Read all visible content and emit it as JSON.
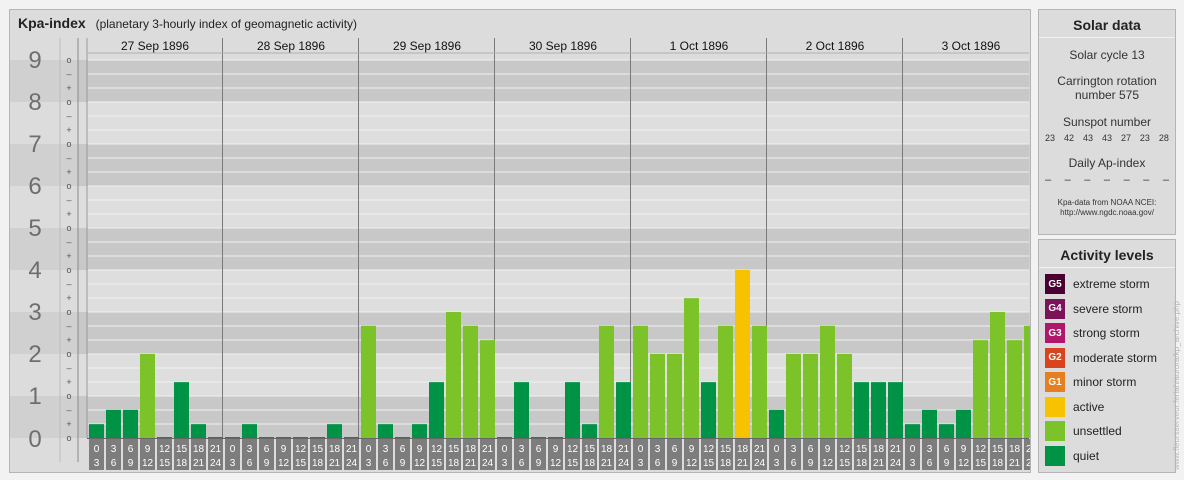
{
  "header": {
    "title": "Kpa-index",
    "subtitle": "(planetary 3-hourly index of geomagnetic activity)"
  },
  "chart_data": {
    "type": "bar",
    "ylim": [
      0,
      9
    ],
    "ytick_labels": [
      "0",
      "1",
      "2",
      "3",
      "4",
      "5",
      "6",
      "7",
      "8",
      "9"
    ],
    "minor_tick_labels": [
      "o",
      "+",
      "–"
    ],
    "days": [
      "27 Sep 1896",
      "28 Sep 1896",
      "29 Sep 1896",
      "30 Sep 1896",
      "1 Oct 1896",
      "2 Oct 1896",
      "3 Oct 1896"
    ],
    "interval_start_hours": [
      "0",
      "3",
      "6",
      "9",
      "12",
      "15",
      "18",
      "21"
    ],
    "interval_end_hours": [
      "3",
      "6",
      "9",
      "12",
      "15",
      "18",
      "21",
      "24"
    ],
    "values": [
      [
        0.33,
        0.67,
        0.67,
        2.0,
        0.0,
        1.33,
        0.33,
        0.0
      ],
      [
        0.0,
        0.33,
        0.0,
        0.0,
        0.0,
        0.0,
        0.33,
        0.0
      ],
      [
        2.67,
        0.33,
        0.0,
        0.33,
        1.33,
        3.0,
        2.67,
        2.33
      ],
      [
        0.0,
        1.33,
        0.0,
        0.0,
        1.33,
        0.33,
        2.67,
        1.33
      ],
      [
        2.67,
        2.0,
        2.0,
        3.33,
        1.33,
        2.67,
        4.0,
        2.67
      ],
      [
        0.67,
        2.0,
        2.0,
        2.67,
        2.0,
        1.33,
        1.33,
        1.33
      ],
      [
        0.33,
        0.67,
        0.33,
        0.67,
        2.33,
        3.0,
        2.33,
        2.67
      ]
    ],
    "colors": {
      "quiet": "#009245",
      "unsettled": "#7cc229",
      "active": "#f7c200",
      "G1": "#e67e22",
      "G2": "#d9441e",
      "G3": "#b0166a",
      "G4": "#7a1358",
      "G5": "#4a0030"
    }
  },
  "solar": {
    "title": "Solar data",
    "cycle": "Solar cycle 13",
    "carrington_line1": "Carrington rotation",
    "carrington_line2": "number 575",
    "sunspot_label": "Sunspot number",
    "sunspots": [
      "23",
      "42",
      "43",
      "43",
      "27",
      "23",
      "28"
    ],
    "ap_label": "Daily Ap-index",
    "ap": [
      "–",
      "–",
      "–",
      "–",
      "–",
      "–",
      "–"
    ],
    "source_line1": "Kpa-data from NOAA NCEI:",
    "source_line2": "http://www.ngdc.noaa.gov/"
  },
  "levels": {
    "title": "Activity levels",
    "items": [
      {
        "badge": "G5",
        "label": "extreme storm",
        "color": "#4a0030"
      },
      {
        "badge": "G4",
        "label": "severe storm",
        "color": "#7a1358"
      },
      {
        "badge": "G3",
        "label": "strong storm",
        "color": "#b0166a"
      },
      {
        "badge": "G2",
        "label": "moderate storm",
        "color": "#d9441e"
      },
      {
        "badge": "G1",
        "label": "minor storm",
        "color": "#e67e22"
      },
      {
        "badge": "",
        "label": "active",
        "color": "#f7c200"
      },
      {
        "badge": "",
        "label": "unsettled",
        "color": "#7cc229"
      },
      {
        "badge": "",
        "label": "quiet",
        "color": "#009245"
      }
    ]
  },
  "watermark": "www.fleursserveur.ferlah/aurora/kp_archive.php"
}
